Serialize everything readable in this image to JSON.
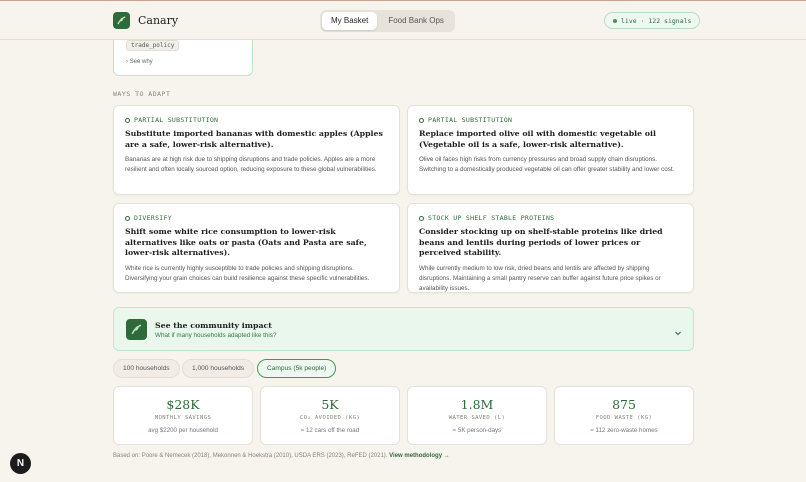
{
  "header": {
    "brand_name": "Canary",
    "tabs": [
      {
        "label": "My Basket",
        "active": true
      },
      {
        "label": "Food Bank Ops",
        "active": false
      }
    ],
    "live_text": "live · 122 signals"
  },
  "previous_card": {
    "tag": "trade_policy",
    "see_why": "› See why"
  },
  "ways_to_adapt": {
    "section_label": "WAYS TO ADAPT",
    "cards": [
      {
        "kind": "PARTIAL SUBSTITUTION",
        "title": "Substitute imported bananas with domestic apples (Apples are a safe, lower-risk alternative).",
        "body": "Bananas are at high risk due to shipping disruptions and trade policies. Apples are a more resilient and often locally sourced option, reducing exposure to these global vulnerabilities."
      },
      {
        "kind": "PARTIAL SUBSTITUTION",
        "title": "Replace imported olive oil with domestic vegetable oil (Vegetable oil is a safe, lower-risk alternative).",
        "body": "Olive oil faces high risks from currency pressures and broad supply chain disruptions. Switching to a domestically produced vegetable oil can offer greater stability and lower cost."
      },
      {
        "kind": "DIVERSIFY",
        "title": "Shift some white rice consumption to lower-risk alternatives like oats or pasta (Oats and Pasta are safe, lower-risk alternatives).",
        "body": "White rice is currently highly susceptible to trade policies and shipping disruptions. Diversifying your grain choices can build resilience against these specific vulnerabilities."
      },
      {
        "kind": "STOCK UP SHELF STABLE PROTEINS",
        "title": "Consider stocking up on shelf-stable proteins like dried beans and lentils during periods of lower prices or perceived stability.",
        "body": "While currently medium to low risk, dried beans and lentils are affected by shipping disruptions. Maintaining a small pantry reserve can buffer against future price spikes or availability issues."
      }
    ]
  },
  "community_impact": {
    "title": "See the community impact",
    "subtitle": "What if many households adapted like this?"
  },
  "scale_options": [
    {
      "label": "100 households",
      "active": false
    },
    {
      "label": "1,000 households",
      "active": false
    },
    {
      "label": "Campus (5k people)",
      "active": true
    }
  ],
  "stats": [
    {
      "value": "$28K",
      "label": "MONTHLY SAVINGS",
      "sub": "avg $2200 per household"
    },
    {
      "value": "5K",
      "label": "CO₂ AVOIDED (KG)",
      "sub": "≈ 12 cars off the road"
    },
    {
      "value": "1.8M",
      "label": "WATER SAVED (L)",
      "sub": "≈ 5K person-days"
    },
    {
      "value": "875",
      "label": "FOOD WASTE (KG)",
      "sub": "≈ 112 zero-waste homes"
    }
  ],
  "footnote": {
    "sources": "Based on: Poore & Nemecek (2018), Mekonnen & Hoekstra (2010), USDA ERS (2023), ReFED (2021).",
    "link": "View methodology →"
  },
  "dev_badge": "N",
  "colors": {
    "brand_green": "#2f6b3a",
    "background": "#f7f4ee",
    "impact_bg": "#eaf7ec"
  }
}
